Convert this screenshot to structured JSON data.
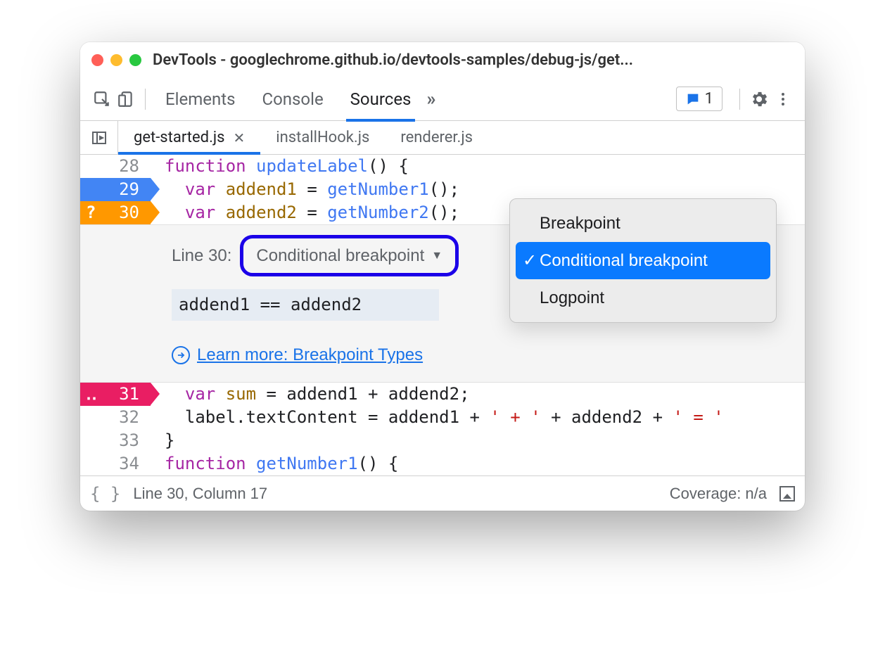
{
  "window": {
    "title": "DevTools - googlechrome.github.io/devtools-samples/debug-js/get..."
  },
  "toolbar": {
    "tabs": [
      "Elements",
      "Console",
      "Sources"
    ],
    "active_tab": "Sources",
    "message_count": "1"
  },
  "file_tabs": {
    "active": "get-started.js",
    "items": [
      {
        "name": "get-started.js",
        "closable": true
      },
      {
        "name": "installHook.js",
        "closable": false
      },
      {
        "name": "renderer.js",
        "closable": false
      }
    ]
  },
  "code": {
    "lines": [
      {
        "n": "28",
        "bp": null,
        "tokens": [
          [
            "kw",
            "function"
          ],
          [
            "sp",
            " "
          ],
          [
            "fn",
            "updateLabel"
          ],
          [
            "id",
            "() {"
          ]
        ]
      },
      {
        "n": "29",
        "bp": "blue",
        "tokens": [
          [
            "sp",
            "  "
          ],
          [
            "kw",
            "var"
          ],
          [
            "sp",
            " "
          ],
          [
            "va",
            "addend1"
          ],
          [
            "id",
            " = "
          ],
          [
            "fn",
            "getNumber1"
          ],
          [
            "id",
            "();"
          ]
        ]
      },
      {
        "n": "30",
        "bp": "orange",
        "badge": "?",
        "tokens": [
          [
            "sp",
            "  "
          ],
          [
            "kw",
            "var"
          ],
          [
            "sp",
            " "
          ],
          [
            "va",
            "addend2"
          ],
          [
            "id",
            " = "
          ],
          [
            "fn",
            "getNumber2"
          ],
          [
            "id",
            "();"
          ]
        ]
      }
    ],
    "lines_after": [
      {
        "n": "31",
        "bp": "pink",
        "badge": "‥",
        "tokens": [
          [
            "sp",
            "  "
          ],
          [
            "kw",
            "var"
          ],
          [
            "sp",
            " "
          ],
          [
            "va",
            "sum"
          ],
          [
            "id",
            " = addend1 + addend2;"
          ]
        ]
      },
      {
        "n": "32",
        "bp": null,
        "tokens": [
          [
            "sp",
            "  "
          ],
          [
            "id",
            "label.textContent = addend1 + "
          ],
          [
            "str",
            "' + '"
          ],
          [
            "id",
            " + addend2 + "
          ],
          [
            "str",
            "' = '"
          ]
        ]
      },
      {
        "n": "33",
        "bp": null,
        "tokens": [
          [
            "id",
            "}"
          ]
        ]
      },
      {
        "n": "34",
        "bp": null,
        "tokens": [
          [
            "kw",
            "function"
          ],
          [
            "sp",
            " "
          ],
          [
            "fn",
            "getNumber1"
          ],
          [
            "id",
            "() {"
          ]
        ]
      }
    ]
  },
  "breakpoint_editor": {
    "line_label": "Line 30:",
    "dropdown_value": "Conditional breakpoint",
    "condition": "addend1 == addend2",
    "learn_more": "Learn more: Breakpoint Types",
    "menu": {
      "items": [
        "Breakpoint",
        "Conditional breakpoint",
        "Logpoint"
      ],
      "selected": "Conditional breakpoint"
    }
  },
  "statusbar": {
    "position": "Line 30, Column 17",
    "coverage": "Coverage: n/a"
  }
}
